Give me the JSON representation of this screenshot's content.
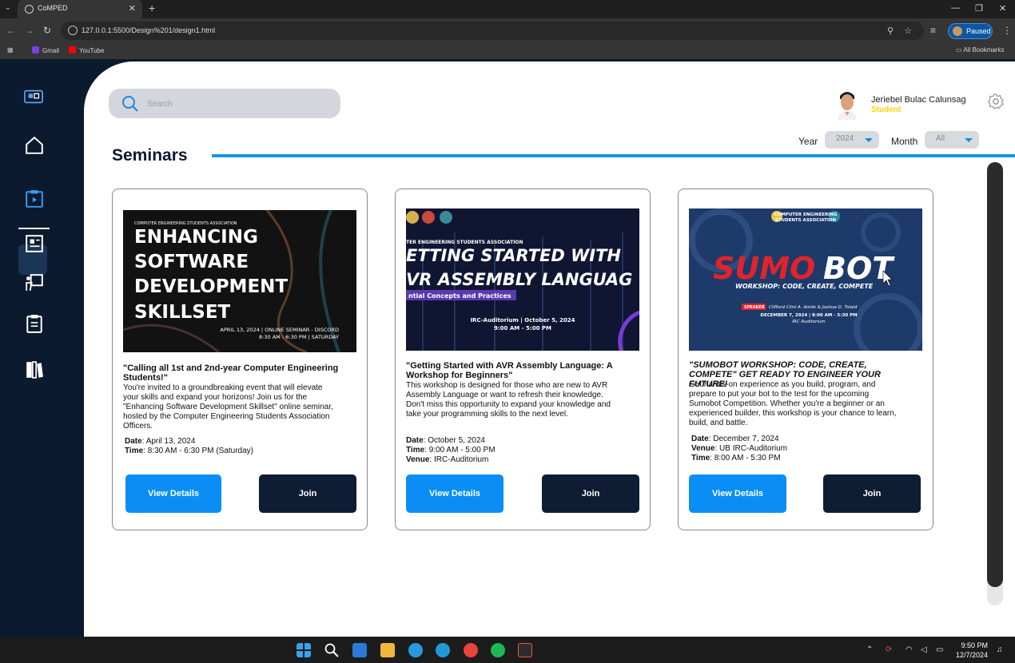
{
  "browser": {
    "tab_title": "CoMPED",
    "url": "127.0.0.1:5500/Design%201/design1.html",
    "profile_status": "Paused",
    "bookmarks": [
      {
        "label": "Gmail",
        "color": "#7b3fe4"
      },
      {
        "label": "YouTube",
        "color": "#ff0000"
      }
    ],
    "all_bookmarks": "All Bookmarks"
  },
  "search": {
    "placeholder": "Search"
  },
  "user": {
    "name": "Jeriebel Bulac Calunsag",
    "role": "Student"
  },
  "filters": {
    "year_label": "Year",
    "year_value": "2024",
    "month_label": "Month",
    "month_value": "All"
  },
  "page": {
    "title": "Seminars"
  },
  "colors": {
    "accent": "#0a8ef5",
    "navy": "#0b1a2e",
    "role": "#ffd500"
  },
  "cards": [
    {
      "banner": {
        "org": "COMPUTER ENGINEERING STUDENTS ASSOCIATION",
        "lines": [
          "ENHANCING",
          "SOFTWARE",
          "DEVELOPMENT",
          "SKILLSET"
        ],
        "footer1": "APRIL 13, 2024 | ONLINE SEMINAR - DISCORD",
        "footer2": "8:30 AM - 6:30 PM | SATURDAY"
      },
      "title": "\"Calling all 1st and 2nd-year Computer Engineering Students!\"",
      "desc": "You're invited to a groundbreaking event that will elevate your skills and expand your horizons! Join us for the \"Enhancing Software Development Skillset\" online seminar, hosted by the Computer Engineering Students Association Officers.",
      "meta": [
        {
          "k": "Date",
          "v": ": April 13, 2024"
        },
        {
          "k": "Time",
          "v": ": 8:30 AM - 6:30 PM (Saturday)"
        }
      ],
      "details_label": "View Details",
      "join_label": "Join"
    },
    {
      "banner": {
        "org": "TER ENGINEERING STUDENTS ASSOCIATION",
        "lines": [
          "ETTING STARTED WITH",
          "VR ASSEMBLY LANGUAG"
        ],
        "sub": "ntial Concepts and Practices",
        "footer1": "IRC-Auditorium | October 5, 2024",
        "footer2": "9:00 AM - 5:00 PM"
      },
      "title": "\"Getting Started with AVR Assembly Language: A Workshop for Beginners\"",
      "desc": "This workshop is designed for those who are new to AVR Assembly Language or want to refresh their knowledge. Don't miss this opportunity to expand your knowledge and take your programming skills to the next level.",
      "meta": [
        {
          "k": "Date",
          "v": ": October 5, 2024"
        },
        {
          "k": "Time",
          "v": ": 9:00 AM - 5:00 PM"
        },
        {
          "k": "Venue",
          "v": ": IRC-Auditorium"
        }
      ],
      "details_label": "View Details",
      "join_label": "Join"
    },
    {
      "banner": {
        "org1": "COMPUTER ENGINEERING",
        "org2": "STUDENTS ASSOCIATION",
        "headline_a": "SUMO",
        "headline_b": "BOT",
        "sub": "WORKSHOP: CODE, CREATE, COMPETE",
        "speaker_tag": "SPEAKER",
        "speaker": "Clifford Clint A. Amile & Joshua D. Tolaid",
        "footer1": "DECEMBER 7, 2024 | 8:00 AM - 5:30 PM",
        "footer2": "IRC Auditorium"
      },
      "title": "\"SUMOBOT WORKSHOP: CODE, CREATE, COMPETE\" GET READY TO ENGINEER YOUR FUTURE!",
      "desc": "Get hands-on experience as you build, program, and prepare to put your bot to the test for the upcoming Sumobot Competition. Whether you're a beginner or an experienced builder, this workshop is your chance to learn, build, and battle.",
      "meta": [
        {
          "k": "Date",
          "v": ": December 7, 2024"
        },
        {
          "k": "Venue",
          "v": ": UB IRC-Auditorium"
        },
        {
          "k": "Time",
          "v": ": 8:00 AM - 5:30 PM"
        }
      ],
      "details_label": "View Details",
      "join_label": "Join"
    }
  ],
  "taskbar": {
    "time": "9:50 PM",
    "date": "12/7/2024"
  }
}
